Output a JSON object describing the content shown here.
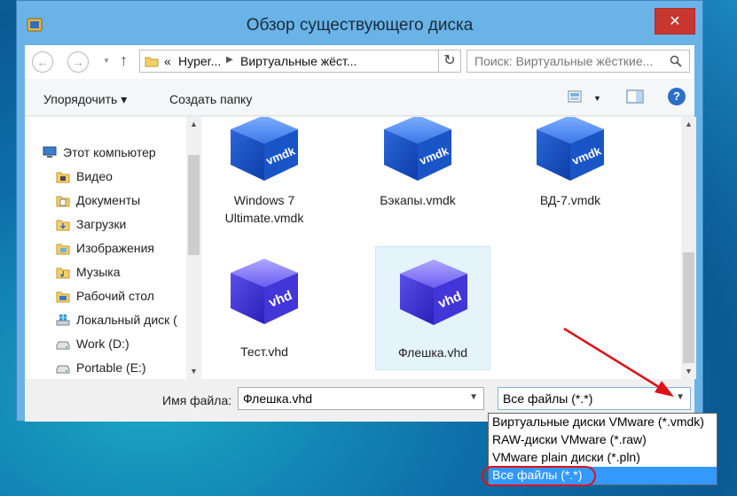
{
  "window": {
    "title": "Обзор существующего диска",
    "close_glyph": "✕"
  },
  "nav": {
    "back_glyph": "←",
    "forward_glyph": "→",
    "up_glyph": "↑",
    "refresh_glyph": "↻",
    "breadcrumb": {
      "prefix": "«",
      "items": [
        "Hyper...",
        "Виртуальные жёст..."
      ]
    },
    "search_placeholder": "Поиск: Виртуальные жёсткие..."
  },
  "toolbar": {
    "organize_label": "Упорядочить ▾",
    "new_folder_label": "Создать папку",
    "help_glyph": "?"
  },
  "sidebar": {
    "root": "Этот компьютер",
    "items": [
      {
        "label": "Видео",
        "icon": "video-folder-icon"
      },
      {
        "label": "Документы",
        "icon": "documents-folder-icon"
      },
      {
        "label": "Загрузки",
        "icon": "downloads-folder-icon"
      },
      {
        "label": "Изображения",
        "icon": "pictures-folder-icon"
      },
      {
        "label": "Музыка",
        "icon": "music-folder-icon"
      },
      {
        "label": "Рабочий стол",
        "icon": "desktop-folder-icon"
      },
      {
        "label": "Локальный диск (",
        "icon": "windows-drive-icon"
      },
      {
        "label": "Work (D:)",
        "icon": "drive-icon"
      },
      {
        "label": "Portable (E:)",
        "icon": "drive-icon"
      }
    ]
  },
  "files": [
    {
      "name": "Windows 7 Ultimate.vmdk",
      "line1": "Windows 7",
      "line2": "Ultimate.vmdk",
      "badge": "vmdk",
      "selected": false
    },
    {
      "name": "Бэкапы.vmdk",
      "line1": "Бэкапы.vmdk",
      "line2": "",
      "badge": "vmdk",
      "selected": false
    },
    {
      "name": "ВД-7.vmdk",
      "line1": "ВД-7.vmdk",
      "line2": "",
      "badge": "vmdk",
      "selected": false
    },
    {
      "name": "Тест.vhd",
      "line1": "Тест.vhd",
      "line2": "",
      "badge": "vhd",
      "selected": false
    },
    {
      "name": "Флешка.vhd",
      "line1": "Флешка.vhd",
      "line2": "",
      "badge": "vhd",
      "selected": true
    }
  ],
  "filename": {
    "label": "Имя файла:",
    "value": "Флешка.vhd"
  },
  "filter": {
    "selected": "Все файлы (*.*)",
    "options": [
      "Виртуальные диски VMware (*.vmdk)",
      "RAW-диски VMware (*.raw)",
      "VMware plain диски (*.pln)",
      "Все файлы (*.*)"
    ]
  },
  "colors": {
    "accent": "#3399ff",
    "close": "#c7372f",
    "annotation": "#e0101a",
    "cube_vmdk": "#2a66d6",
    "cube_vhd": "#4a4ad8"
  }
}
